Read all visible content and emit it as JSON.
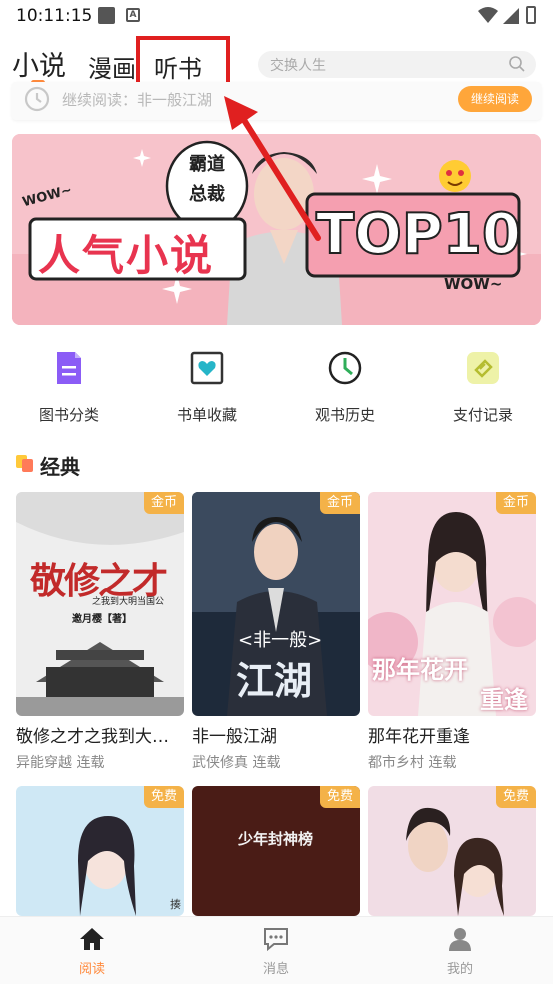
{
  "status_bar": {
    "time": "10:11:15"
  },
  "tabs": {
    "novel": "小说",
    "comic": "漫画",
    "audiobook": "听书"
  },
  "search": {
    "placeholder": "交换人生"
  },
  "continue_reading": {
    "text": "继续阅读：非一般江湖",
    "button": "继续阅读"
  },
  "banner": {
    "bubble_line1": "霸道",
    "bubble_line2": "总裁",
    "wow_left": "WOW~",
    "headline": "人气小说",
    "top": "TOP10",
    "wow_right": "WOW~"
  },
  "quick_links": [
    {
      "label": "图书分类",
      "icon": "book-category-icon"
    },
    {
      "label": "书单收藏",
      "icon": "heart-bookmark-icon"
    },
    {
      "label": "观书历史",
      "icon": "history-clock-icon"
    },
    {
      "label": "支付记录",
      "icon": "payment-record-icon"
    }
  ],
  "section": {
    "title": "经典"
  },
  "books": [
    {
      "title": "敬修之才之我到大…",
      "meta": "异能穿越 连载",
      "badge": "金币",
      "cover_text": "敬修之才",
      "cover_sub": "之我到大明当国公",
      "cover_author": "邀月樱【著】"
    },
    {
      "title": "非一般江湖",
      "meta": "武侠修真 连载",
      "badge": "金币",
      "cover_text": "江湖",
      "cover_sub": "<非一般>"
    },
    {
      "title": "那年花开重逢",
      "meta": "都市乡村 连载",
      "badge": "金币",
      "cover_text": "那年花开",
      "cover_sub": "重逢"
    },
    {
      "badge": "免费",
      "cover_side": "揍"
    },
    {
      "badge": "免费",
      "cover_text": "少年封神榜"
    },
    {
      "badge": "免费"
    }
  ],
  "bottom_nav": {
    "read": "阅读",
    "messages": "消息",
    "mine": "我的"
  },
  "colors": {
    "accent": "#ff8a3d",
    "button_orange": "#ffa63a",
    "badge": "#f4b248",
    "highlight_red": "#e02020"
  }
}
